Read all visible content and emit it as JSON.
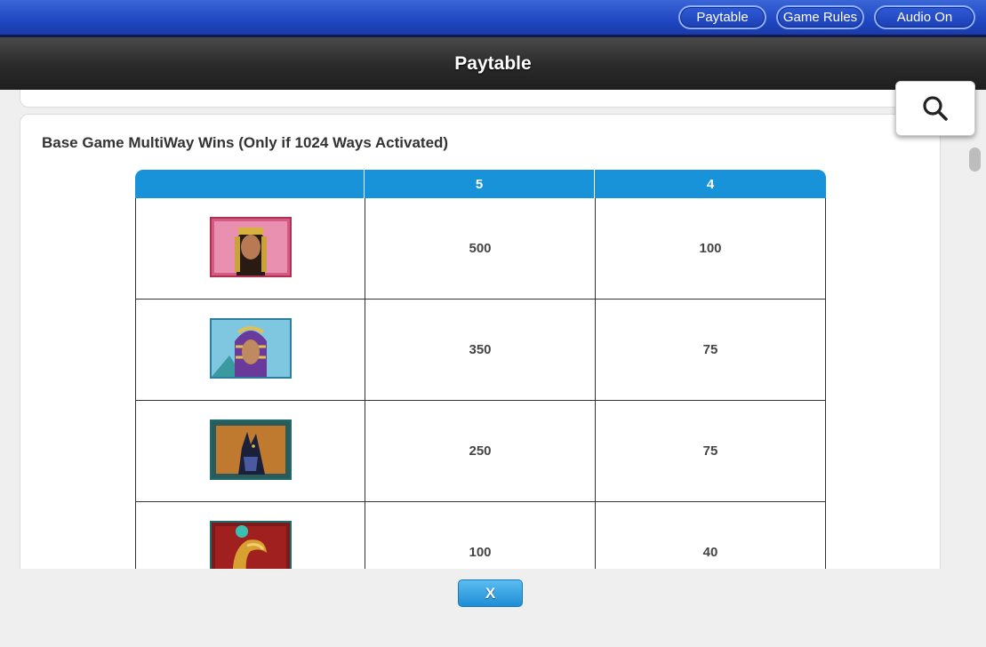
{
  "topbar": {
    "buttons": [
      {
        "label": "Paytable"
      },
      {
        "label": "Game Rules"
      },
      {
        "label": "Audio On"
      }
    ]
  },
  "header": {
    "title": "Paytable"
  },
  "section": {
    "title": "Base Game MultiWay Wins (Only if 1024 Ways Activated)",
    "columns": [
      "",
      "5",
      "4"
    ],
    "rows": [
      {
        "symbol": "cleopatra",
        "v5": "500",
        "v4": "100"
      },
      {
        "symbol": "pharaoh",
        "v5": "350",
        "v4": "75"
      },
      {
        "symbol": "anubis",
        "v5": "250",
        "v4": "75"
      },
      {
        "symbol": "horus",
        "v5": "100",
        "v4": "40"
      }
    ]
  },
  "search": {
    "icon": "magnifier-icon"
  },
  "footer": {
    "close_label": "X"
  },
  "colors": {
    "topbar": "#1f47c2",
    "table_header": "#1892d8",
    "close_button": "#2f9fe0"
  }
}
